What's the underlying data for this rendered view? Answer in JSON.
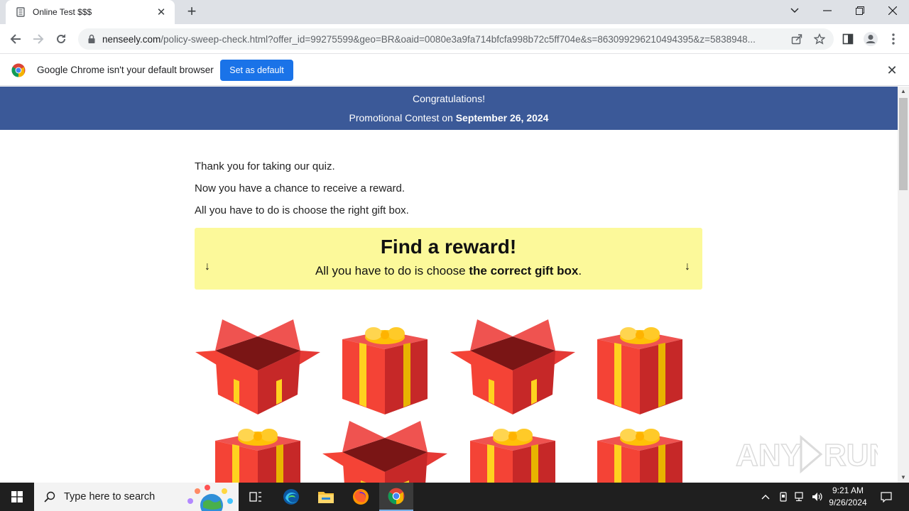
{
  "browser": {
    "tab_title": "Online Test $$$",
    "new_tab_label": "+",
    "url_host": "nenseely.com",
    "url_rest": "/policy-sweep-check.html?offer_id=99275599&geo=BR&oaid=0080e3a9fa714bfcfa998b72c5ff704e&s=863099296210494395&z=5838948..."
  },
  "infobar": {
    "message": "Google Chrome isn't your default browser",
    "button_label": "Set as default"
  },
  "page": {
    "banner_line1": "Congratulations!",
    "banner_line2_prefix": "Promotional Contest on",
    "banner_date": "September 26, 2024",
    "para1": "Thank you for taking our quiz.",
    "para2": "Now you have a chance to receive a reward.",
    "para3": "All you have to do is choose the right gift box.",
    "reward_heading": "Find a reward!",
    "reward_sub_prefix": "All you have to do is choose",
    "reward_sub_bold": "the correct gift box",
    "reward_sub_suffix": ".",
    "arrow_glyph": "↓"
  },
  "taskbar": {
    "search_placeholder": "Type here to search",
    "time": "9:21 AM",
    "date": "9/26/2024"
  },
  "watermark": "ANY RUN",
  "colors": {
    "banner": "#3b5998",
    "reward_box": "#fcf99a",
    "accent_button": "#1a73e8",
    "gift_red": "#e53935",
    "gift_ribbon": "#ffd21f"
  }
}
